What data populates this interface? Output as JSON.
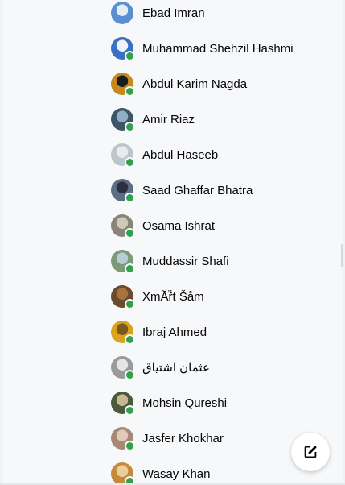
{
  "contacts": [
    {
      "name": "Ebad Imran",
      "online": false,
      "avatar": "#5b8ed1",
      "avatar2": "#e7edf6"
    },
    {
      "name": "Muhammad Shehzil Hashmi",
      "online": true,
      "avatar": "#3a6fc4",
      "avatar2": "#eef3fb"
    },
    {
      "name": "Abdul Karim Nagda",
      "online": true,
      "avatar": "#c58a1b",
      "avatar2": "#1c1c1c"
    },
    {
      "name": "Amir Riaz",
      "online": true,
      "avatar": "#3f5566",
      "avatar2": "#8fb0c4"
    },
    {
      "name": "Abdul Haseeb",
      "online": true,
      "avatar": "#bcc6cf",
      "avatar2": "#e8ecef"
    },
    {
      "name": "Saad Ghaffar Bhatra",
      "online": true,
      "avatar": "#5e6d86",
      "avatar2": "#2b2f3f"
    },
    {
      "name": "Osama Ishrat",
      "online": true,
      "avatar": "#8a8478",
      "avatar2": "#d0c8b8"
    },
    {
      "name": "Muddassir Shafi",
      "online": true,
      "avatar": "#7b9b78",
      "avatar2": "#b9cbd6"
    },
    {
      "name": "XmĂř̈t Šåm",
      "online": true,
      "avatar": "#6b4a2f",
      "avatar2": "#a7733f"
    },
    {
      "name": "Ibraj Ahmed",
      "online": true,
      "avatar": "#d9a31c",
      "avatar2": "#7a5a1c"
    },
    {
      "name": "عثمان اشتیاق",
      "online": true,
      "avatar": "#9a9a9a",
      "avatar2": "#e5e5e5"
    },
    {
      "name": "Mohsin Qureshi",
      "online": true,
      "avatar": "#4a5a3a",
      "avatar2": "#c9b791"
    },
    {
      "name": "Jasfer Khokhar",
      "online": true,
      "avatar": "#a88a74",
      "avatar2": "#e0cbb9"
    },
    {
      "name": "Wasay Khan",
      "online": true,
      "avatar": "#c58b3d",
      "avatar2": "#eccd9c"
    }
  ],
  "compose": {
    "icon": "new-message-icon"
  },
  "colors": {
    "online": "#31a24c",
    "text": "#050505",
    "panel": "#f7f8fa"
  }
}
